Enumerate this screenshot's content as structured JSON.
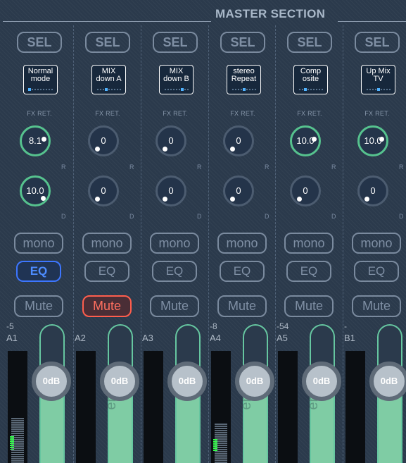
{
  "section_title": "MASTER SECTION",
  "colors": {
    "accent_green": "#56c28e",
    "eq_active": "#3d76ff",
    "mute_active": "#ff5e4d",
    "meter_green": "#34ff4a"
  },
  "strips": [
    {
      "sel": "SEL",
      "mode_line1": "Normal",
      "mode_line2": "mode",
      "mode_dot": 0,
      "fx_ret": "FX RET.",
      "knob_r": "8.1",
      "knob_r_on": true,
      "knob_r_label": "R",
      "knob_d": "10.0",
      "knob_d_on": true,
      "knob_d_label": "D",
      "mono": "mono",
      "eq": "EQ",
      "eq_on": true,
      "mute": "Mute",
      "mute_on": false,
      "level_db": "-5",
      "bus": "A1",
      "fader_value": "0dB",
      "fader_label": "",
      "meter_level": 0.4
    },
    {
      "sel": "SEL",
      "mode_line1": "MIX",
      "mode_line2": "down A",
      "mode_dot": 3,
      "fx_ret": "FX RET.",
      "knob_r": "0",
      "knob_r_on": false,
      "knob_r_label": "R",
      "knob_d": "0",
      "knob_d_on": false,
      "knob_d_label": "D",
      "mono": "mono",
      "eq": "EQ",
      "eq_on": false,
      "mute": "Mute",
      "mute_on": true,
      "level_db": "",
      "bus": "A2",
      "fader_value": "0dB",
      "fader_label": "er Gain",
      "meter_level": 0
    },
    {
      "sel": "SEL",
      "mode_line1": "MIX",
      "mode_line2": "down B",
      "mode_dot": 6,
      "fx_ret": "FX RET.",
      "knob_r": "0",
      "knob_r_on": false,
      "knob_r_label": "R",
      "knob_d": "0",
      "knob_d_on": false,
      "knob_d_label": "D",
      "mono": "mono",
      "eq": "EQ",
      "eq_on": false,
      "mute": "Mute",
      "mute_on": false,
      "level_db": "",
      "bus": "A3",
      "fader_value": "0dB",
      "fader_label": "",
      "meter_level": 0
    },
    {
      "sel": "SEL",
      "mode_line1": "stereo",
      "mode_line2": "Repeat",
      "mode_dot": 4,
      "fx_ret": "FX RET.",
      "knob_r": "0",
      "knob_r_on": false,
      "knob_r_label": "R",
      "knob_d": "0",
      "knob_d_on": false,
      "knob_d_label": "D",
      "mono": "mono",
      "eq": "EQ",
      "eq_on": false,
      "mute": "Mute",
      "mute_on": false,
      "level_db": "-8",
      "bus": "A4",
      "fader_value": "0dB",
      "fader_label": "er Gain",
      "meter_level": 0.35
    },
    {
      "sel": "SEL",
      "mode_line1": "Comp",
      "mode_line2": "osite",
      "mode_dot": 2,
      "fx_ret": "FX RET.",
      "knob_r": "10.0",
      "knob_r_on": true,
      "knob_r_label": "R",
      "knob_d": "0",
      "knob_d_on": false,
      "knob_d_label": "D",
      "mono": "mono",
      "eq": "EQ",
      "eq_on": false,
      "mute": "Mute",
      "mute_on": false,
      "level_db": "-54",
      "bus": "A5",
      "fader_value": "0dB",
      "fader_label": "er Gain",
      "meter_level": 0
    },
    {
      "sel": "SEL",
      "mode_line1": "Up Mix",
      "mode_line2": "TV",
      "mode_dot": 4,
      "fx_ret": "FX RET.",
      "knob_r": "10.0",
      "knob_r_on": true,
      "knob_r_label": "R",
      "knob_d": "0",
      "knob_d_on": false,
      "knob_d_label": "D",
      "mono": "mono",
      "eq": "EQ",
      "eq_on": false,
      "mute": "Mute",
      "mute_on": false,
      "level_db": "-",
      "bus": "B1",
      "fader_value": "0dB",
      "fader_label": "",
      "meter_level": 0
    }
  ]
}
